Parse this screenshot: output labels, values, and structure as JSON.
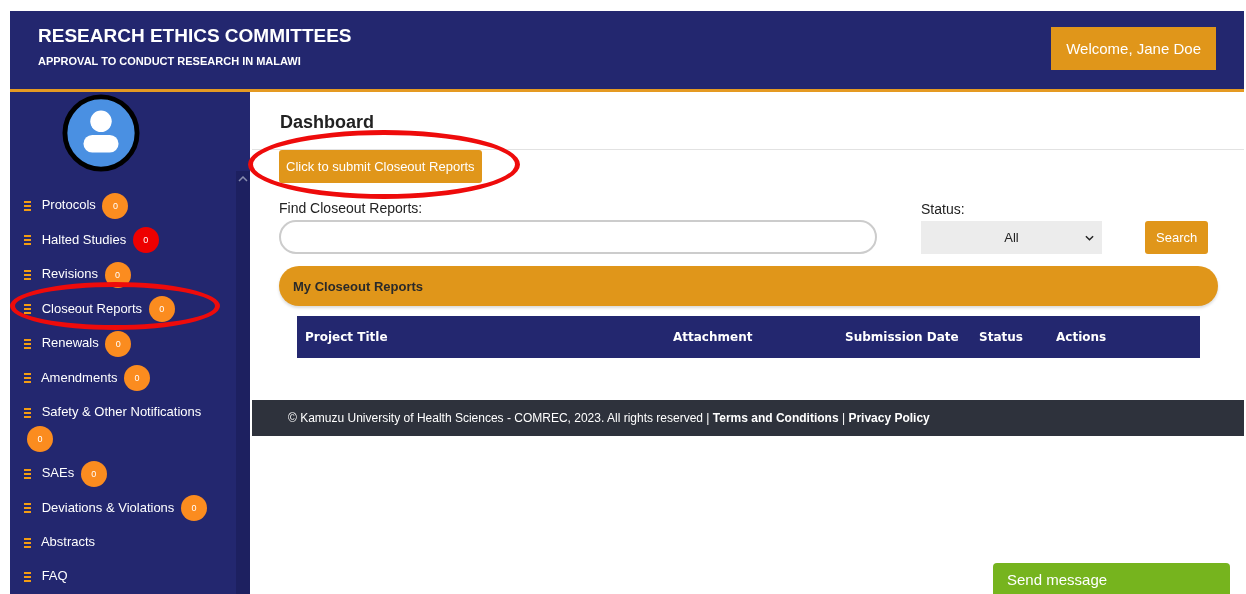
{
  "header": {
    "title": "RESEARCH ETHICS COMMITTEES",
    "subtitle": "APPROVAL TO CONDUCT RESEARCH IN MALAWI",
    "welcome": "Welcome, Jane Doe"
  },
  "sidebar": {
    "items": [
      {
        "label": "Protocols",
        "badge": "0",
        "color": "#fb8c1f",
        "circled": false
      },
      {
        "label": "Halted Studies",
        "badge": "0",
        "color": "#ee0000",
        "circled": false
      },
      {
        "label": "Revisions",
        "badge": "0",
        "color": "#fb8c1f",
        "circled": false
      },
      {
        "label": "Closeout Reports",
        "badge": "0",
        "color": "#fb8c1f",
        "circled": true
      },
      {
        "label": "Renewals",
        "badge": "0",
        "color": "#fb8c1f",
        "circled": false
      },
      {
        "label": "Amendments",
        "badge": "0",
        "color": "#fb8c1f",
        "circled": false
      },
      {
        "label": "Safety & Other Notifications",
        "badge": "0",
        "color": "#fb8c1f",
        "circled": false
      },
      {
        "label": "SAEs",
        "badge": "0",
        "color": "#fb8c1f",
        "circled": false
      },
      {
        "label": "Deviations & Violations",
        "badge": "0",
        "color": "#fb8c1f",
        "circled": false
      },
      {
        "label": "Abstracts",
        "circled": false
      },
      {
        "label": "FAQ",
        "circled": false
      }
    ]
  },
  "main": {
    "heading": "Dashboard",
    "submit_button": {
      "label": "Click to submit Closeout Reports",
      "circled": true
    },
    "search": {
      "label": "Find Closeout Reports:"
    },
    "status": {
      "label": "Status:",
      "value": "All"
    },
    "search_button": "Search",
    "panel_title": "My Closeout Reports",
    "table": {
      "columns": [
        "Project Title",
        "Attachment",
        "Submission Date",
        "Status",
        "Actions"
      ]
    }
  },
  "footer": {
    "text": "© Kamuzu University of Health Sciences - COMREC, 2023. All rights reserved |",
    "links": [
      "Terms and Conditions",
      "Privacy Policy"
    ],
    "separator": "|"
  },
  "chat_button": "Send message"
}
